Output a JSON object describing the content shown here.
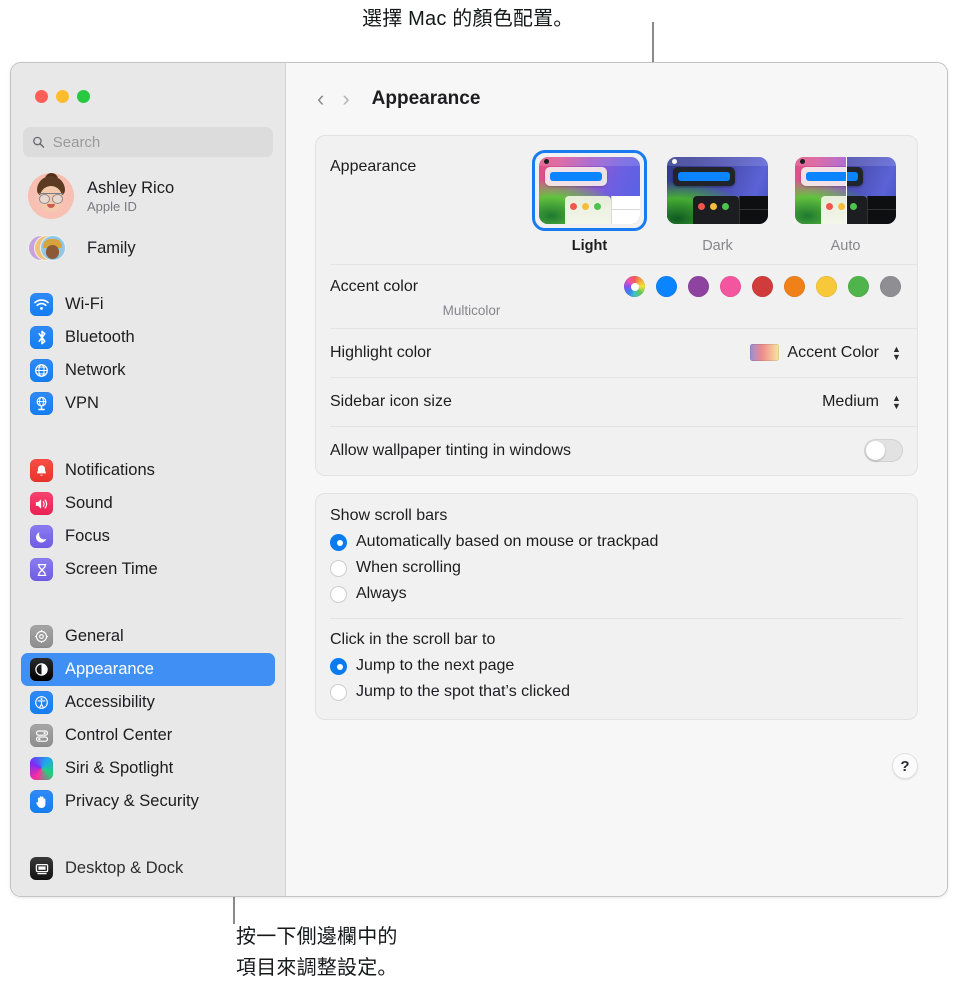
{
  "callouts": {
    "top": "選擇 Mac 的顏色配置。",
    "bottom": "按一下側邊欄中的\n項目來調整設定。"
  },
  "window": {
    "traffic_lights": [
      "close-red",
      "minimize-yellow",
      "zoom-green"
    ],
    "traffic_colors": {
      "red": "#ff5f57",
      "yellow": "#febc2e",
      "green": "#28c840"
    }
  },
  "sidebar": {
    "search": {
      "placeholder": "Search",
      "value": "",
      "icon": "search-icon"
    },
    "account": {
      "name": "Ashley Rico",
      "subtitle": "Apple ID",
      "avatar": "memoji-avatar"
    },
    "family": {
      "label": "Family",
      "icon": "family-avatars-icon"
    },
    "groups": [
      {
        "items": [
          {
            "label": "Wi-Fi",
            "icon": "wifi-icon",
            "glyph": "",
            "selected": false
          },
          {
            "label": "Bluetooth",
            "icon": "bluetooth-icon",
            "glyph": "",
            "selected": false
          },
          {
            "label": "Network",
            "icon": "network-globe-icon",
            "glyph": "",
            "selected": false
          },
          {
            "label": "VPN",
            "icon": "vpn-icon",
            "glyph": "",
            "selected": false
          }
        ]
      },
      {
        "items": [
          {
            "label": "Notifications",
            "icon": "notifications-bell-icon",
            "selected": false
          },
          {
            "label": "Sound",
            "icon": "sound-speaker-icon",
            "selected": false
          },
          {
            "label": "Focus",
            "icon": "focus-moon-icon",
            "selected": false
          },
          {
            "label": "Screen Time",
            "icon": "screen-time-hourglass-icon",
            "selected": false
          }
        ]
      },
      {
        "items": [
          {
            "label": "General",
            "icon": "general-gear-icon",
            "selected": false
          },
          {
            "label": "Appearance",
            "icon": "appearance-contrast-icon",
            "selected": true
          },
          {
            "label": "Accessibility",
            "icon": "accessibility-icon",
            "selected": false
          },
          {
            "label": "Control Center",
            "icon": "control-center-icon",
            "selected": false
          },
          {
            "label": "Siri & Spotlight",
            "icon": "siri-icon",
            "selected": false
          },
          {
            "label": "Privacy & Security",
            "icon": "privacy-hand-icon",
            "selected": false
          }
        ]
      },
      {
        "items": [
          {
            "label": "Desktop & Dock",
            "icon": "desktop-dock-icon",
            "selected": false
          }
        ]
      }
    ]
  },
  "toolbar": {
    "back_icon": "chevron-left-icon",
    "forward_icon": "chevron-right-icon",
    "title": "Appearance"
  },
  "main": {
    "appearance": {
      "label": "Appearance",
      "options": [
        {
          "label": "Light",
          "selected": true
        },
        {
          "label": "Dark",
          "selected": false
        },
        {
          "label": "Auto",
          "selected": false
        }
      ]
    },
    "accent": {
      "label": "Accent color",
      "caption": "Multicolor",
      "selected_index": 0,
      "swatches": [
        {
          "name": "Multicolor",
          "color": "multicolor"
        },
        {
          "name": "Blue",
          "color": "#0a84ff"
        },
        {
          "name": "Purple",
          "color": "#8e43a0"
        },
        {
          "name": "Pink",
          "color": "#f3569f"
        },
        {
          "name": "Red",
          "color": "#d03c3c"
        },
        {
          "name": "Orange",
          "color": "#f08118"
        },
        {
          "name": "Yellow",
          "color": "#f7c93a"
        },
        {
          "name": "Green",
          "color": "#50b44c"
        },
        {
          "name": "Graphite",
          "color": "#8e8e93"
        }
      ]
    },
    "highlight": {
      "label": "Highlight color",
      "value": "Accent Color",
      "swatch_gradient": [
        "#9b8fd6",
        "#f08c8c",
        "#f7e7a0"
      ],
      "control": "popup-button"
    },
    "sidebar_icon_size": {
      "label": "Sidebar icon size",
      "value": "Medium",
      "control": "popup-button"
    },
    "wallpaper_tinting": {
      "label": "Allow wallpaper tinting in windows",
      "value": "off",
      "control": "switch"
    },
    "show_scroll_bars": {
      "label": "Show scroll bars",
      "options": [
        {
          "label": "Automatically based on mouse or trackpad",
          "selected": true
        },
        {
          "label": "When scrolling",
          "selected": false
        },
        {
          "label": "Always",
          "selected": false
        }
      ]
    },
    "click_scroll_bar": {
      "label": "Click in the scroll bar to",
      "options": [
        {
          "label": "Jump to the next page",
          "selected": true
        },
        {
          "label": "Jump to the spot that’s clicked",
          "selected": false
        }
      ]
    },
    "help": {
      "label": "?",
      "icon": "help-question-icon"
    }
  }
}
